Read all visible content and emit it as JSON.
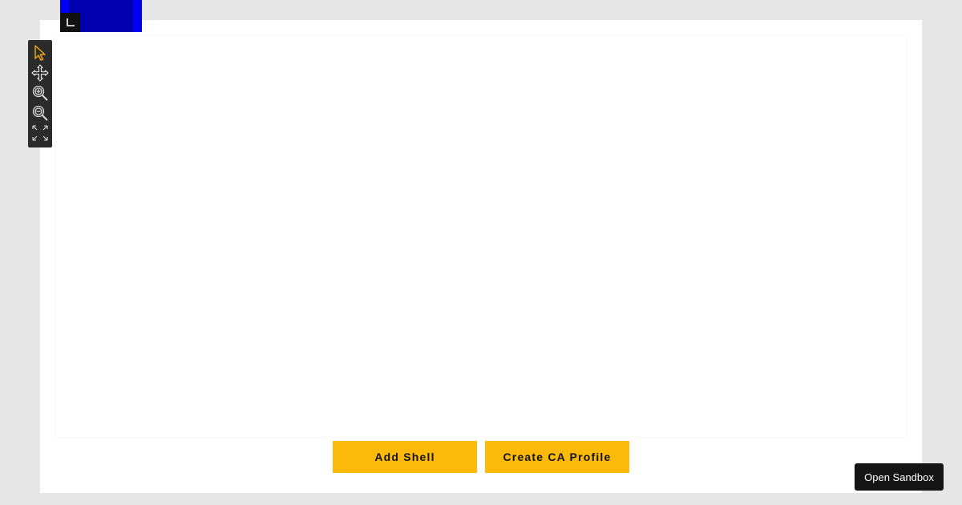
{
  "toolbar": {
    "tools": [
      {
        "name": "pointer-icon",
        "active": true
      },
      {
        "name": "pan-icon",
        "active": false
      },
      {
        "name": "zoom-in-icon",
        "active": false
      },
      {
        "name": "zoom-out-icon",
        "active": false
      },
      {
        "name": "fit-to-screen-icon",
        "active": false
      }
    ],
    "active_color": "#e8a317",
    "icon_color": "#dddddd"
  },
  "actions": {
    "add_shell_label": "Add Shell",
    "create_ca_profile_label": "Create CA Profile",
    "accent_color": "#fbba0a"
  },
  "sandbox": {
    "open_label": "Open Sandbox"
  }
}
